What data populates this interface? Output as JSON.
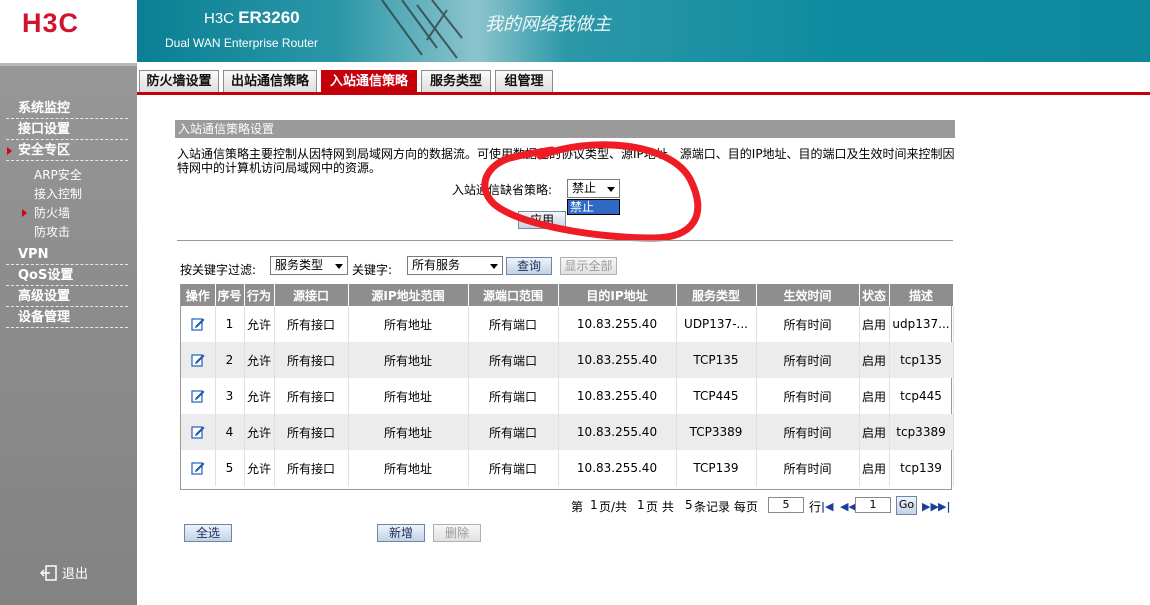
{
  "brand": {
    "logo": "H3C",
    "model_prefix": "H3C",
    "model": "ER3260",
    "subtitle": "Dual WAN Enterprise Router",
    "slogan": "我的网络我做主"
  },
  "sidebar": {
    "items": [
      {
        "label": "系统监控"
      },
      {
        "label": "接口设置"
      },
      {
        "label": "安全专区"
      }
    ],
    "sub_items": [
      {
        "label": "ARP安全"
      },
      {
        "label": "接入控制"
      },
      {
        "label": "防火墙"
      },
      {
        "label": "防攻击"
      }
    ],
    "items2": [
      {
        "label": "VPN"
      },
      {
        "label": "QoS设置"
      },
      {
        "label": "高级设置"
      },
      {
        "label": "设备管理"
      }
    ],
    "logout": "退出"
  },
  "tabs": [
    {
      "label": "防火墙设置"
    },
    {
      "label": "出站通信策略"
    },
    {
      "label": "入站通信策略"
    },
    {
      "label": "服务类型"
    },
    {
      "label": "组管理"
    }
  ],
  "section": {
    "title": "入站通信策略设置",
    "description": "入站通信策略主要控制从因特网到局域网方向的数据流。可使用数据包的协议类型、源IP地址、源端口、目的IP地址、目的端口及生效时间来控制因特网中的计算机访问局域网中的资源。",
    "default_policy_label": "入站通信缺省策略:",
    "default_policy_value": "禁止",
    "dropdown_option": "禁止",
    "apply": "应用"
  },
  "filter": {
    "label": "按关键字过滤:",
    "field_value": "服务类型",
    "keyword_label": "关键字:",
    "keyword_value": "所有服务",
    "query": "查询",
    "show_all": "显示全部"
  },
  "table": {
    "headers": [
      "操作",
      "序号",
      "行为",
      "源接口",
      "源IP地址范围",
      "源端口范围",
      "目的IP地址",
      "服务类型",
      "生效时间",
      "状态",
      "描述"
    ],
    "rows": [
      [
        "",
        "1",
        "允许",
        "所有接口",
        "所有地址",
        "所有端口",
        "10.83.255.40",
        "UDP137-...",
        "所有时间",
        "启用",
        "udp137..."
      ],
      [
        "",
        "2",
        "允许",
        "所有接口",
        "所有地址",
        "所有端口",
        "10.83.255.40",
        "TCP135",
        "所有时间",
        "启用",
        "tcp135"
      ],
      [
        "",
        "3",
        "允许",
        "所有接口",
        "所有地址",
        "所有端口",
        "10.83.255.40",
        "TCP445",
        "所有时间",
        "启用",
        "tcp445"
      ],
      [
        "",
        "4",
        "允许",
        "所有接口",
        "所有地址",
        "所有端口",
        "10.83.255.40",
        "TCP3389",
        "所有时间",
        "启用",
        "tcp3389"
      ],
      [
        "",
        "5",
        "允许",
        "所有接口",
        "所有地址",
        "所有端口",
        "10.83.255.40",
        "TCP139",
        "所有时间",
        "启用",
        "tcp139"
      ]
    ]
  },
  "pager": {
    "text1": "第",
    "page": "1",
    "text2": "页/共",
    "total_pages": "1",
    "text3": "页 共",
    "records": "5",
    "text4": "条记录 每页",
    "per_page": "5",
    "text5": "行",
    "goto_value": "1",
    "go": "Go"
  },
  "bottom": {
    "select_all": "全选",
    "add": "新增",
    "delete": "删除"
  },
  "colors": {
    "accent": "#c5000b",
    "banner": "#0e889c",
    "sidebar": "#8c8c8c",
    "header": "#8e8e8e"
  },
  "icons": {
    "edit": "edit-icon",
    "logout": "logout-icon"
  }
}
